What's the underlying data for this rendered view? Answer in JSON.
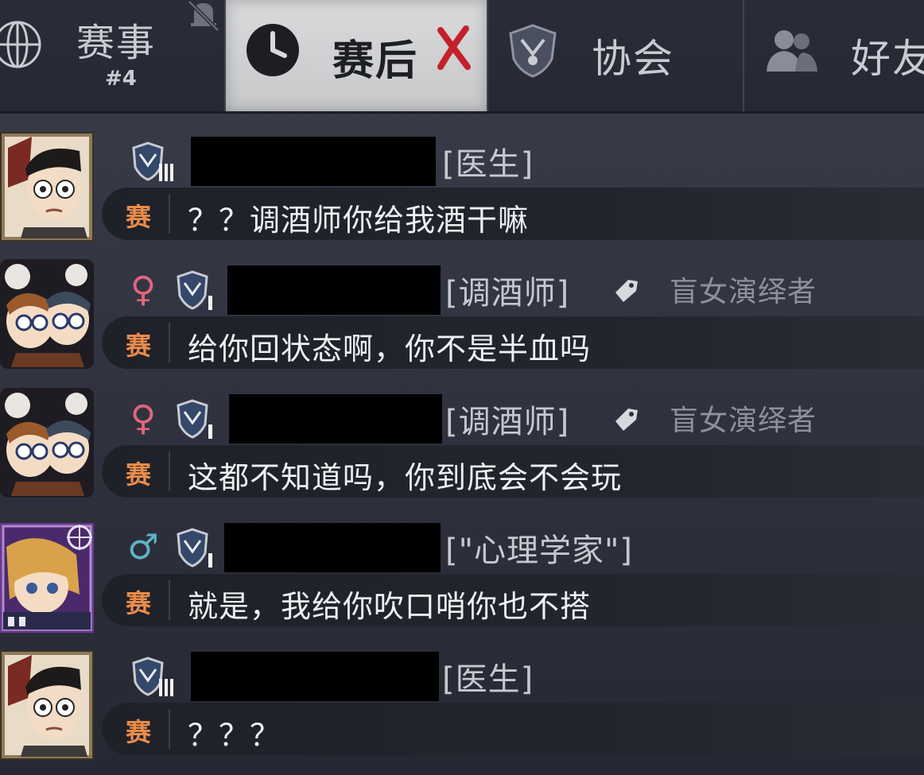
{
  "tabs": {
    "events": {
      "label": "赛事",
      "count": "#4"
    },
    "post_match": {
      "label": "赛后"
    },
    "guild": {
      "label": "协会"
    },
    "friends": {
      "label": "好友"
    }
  },
  "channel_label": "赛",
  "messages": [
    {
      "gender": "",
      "role": "[医生]",
      "title": "",
      "text": "？？调酒师你给我酒干嘛"
    },
    {
      "gender": "♀",
      "role": "[调酒师]",
      "title": "盲女演绎者",
      "text": "给你回状态啊，你不是半血吗"
    },
    {
      "gender": "♀",
      "role": "[调酒师]",
      "title": "盲女演绎者",
      "text": "这都不知道吗，你到底会不会玩"
    },
    {
      "gender": "♂",
      "role": "[\"心理学家\"]",
      "title": "",
      "text": "就是，我给你吹口哨你也不搭"
    },
    {
      "gender": "",
      "role": "[医生]",
      "title": "",
      "text": "？？？"
    }
  ],
  "colors": {
    "female": "#e0667a",
    "male": "#5fb3c6",
    "channel": "#e98c4a",
    "close_x": "#c4202a"
  },
  "icons": [
    "globe-icon",
    "bell-off-icon",
    "clock-icon",
    "close-x-icon",
    "shield-icon",
    "people-icon",
    "rank-badge-icon",
    "tag-icon"
  ]
}
